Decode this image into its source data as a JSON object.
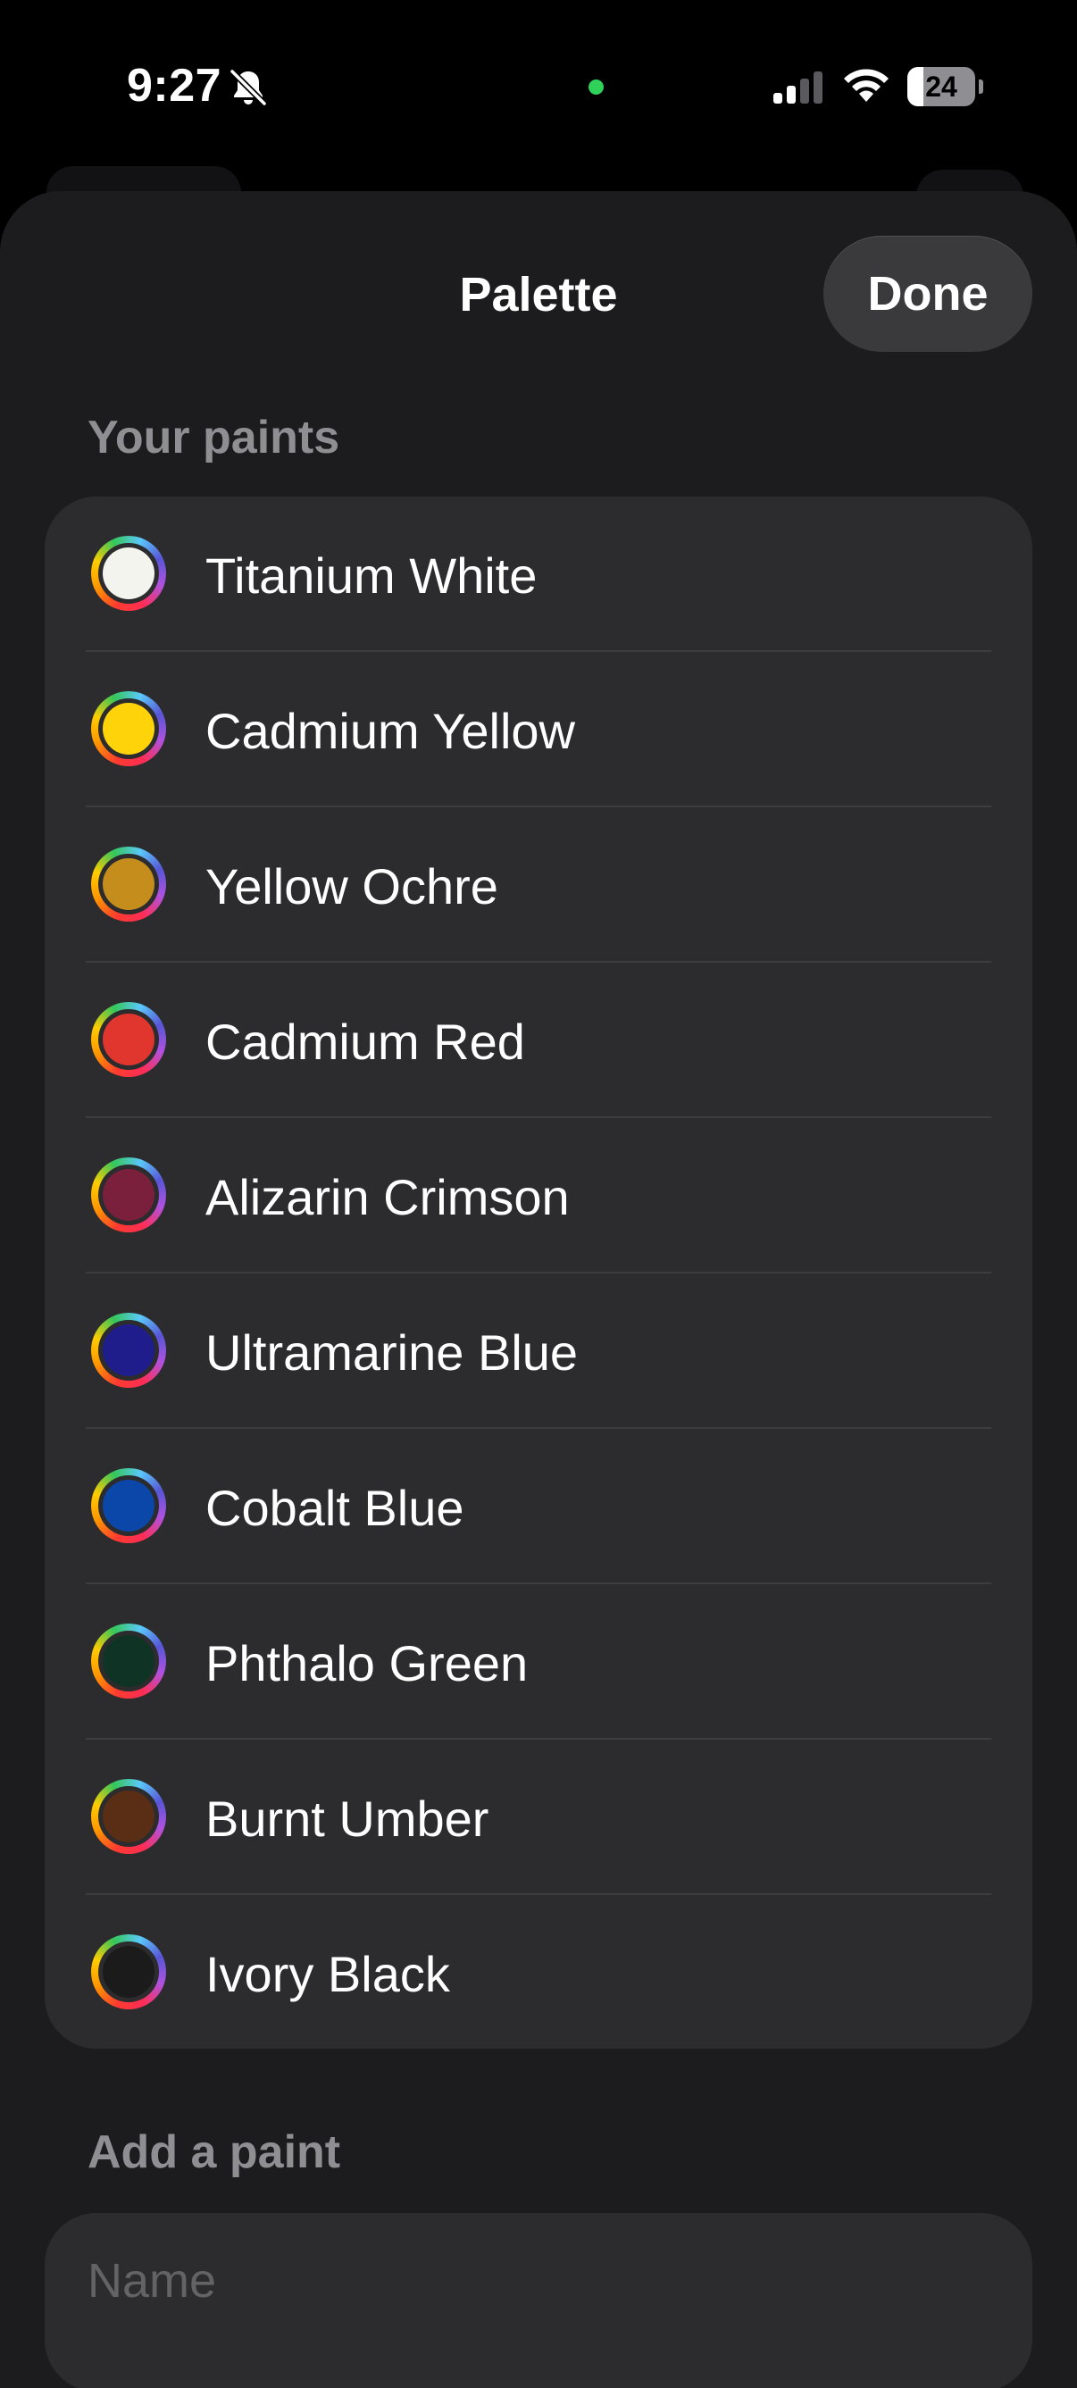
{
  "status_bar": {
    "time": "9:27",
    "battery_level": "24",
    "battery_fraction": 0.24,
    "icons": [
      "bell-slash-icon",
      "signal-icon",
      "wifi-icon",
      "battery-icon"
    ],
    "indicator_color": "#30d158"
  },
  "sheet": {
    "title": "Palette",
    "done_label": "Done"
  },
  "paints_section": {
    "header": "Your paints",
    "items": [
      {
        "name": "Titanium White",
        "color": "#f4f4ef"
      },
      {
        "name": "Cadmium Yellow",
        "color": "#ffd30a"
      },
      {
        "name": "Yellow Ochre",
        "color": "#c48d1c"
      },
      {
        "name": "Cadmium Red",
        "color": "#e0362e"
      },
      {
        "name": "Alizarin Crimson",
        "color": "#7a1f3c"
      },
      {
        "name": "Ultramarine Blue",
        "color": "#1f1d8c"
      },
      {
        "name": "Cobalt Blue",
        "color": "#0a47a8"
      },
      {
        "name": "Phthalo Green",
        "color": "#0f3324"
      },
      {
        "name": "Burnt Umber",
        "color": "#5a2e14"
      },
      {
        "name": "Ivory Black",
        "color": "#1c1b1c"
      }
    ]
  },
  "add_section": {
    "header": "Add a paint",
    "name_placeholder": "Name",
    "name_value": ""
  },
  "colors": {
    "sheet_background": "#1c1c1e",
    "card_background": "#2c2c2e",
    "secondary_label": "#8e8e93"
  }
}
